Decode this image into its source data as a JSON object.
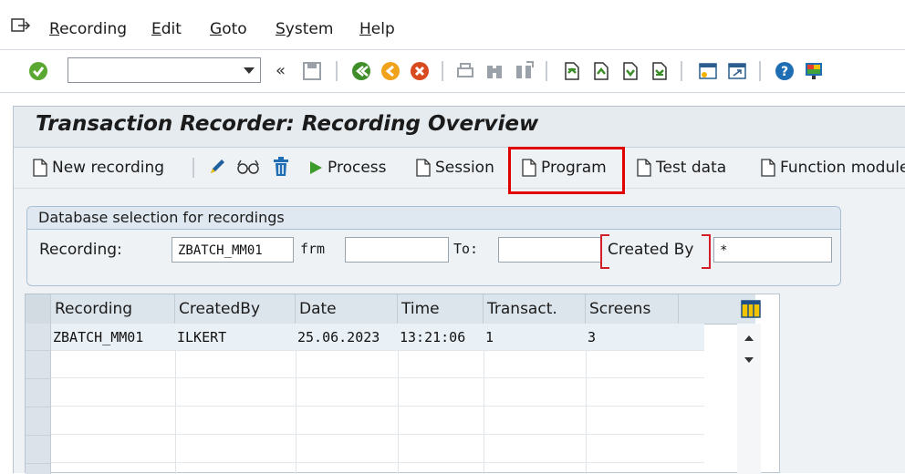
{
  "menu": {
    "items": [
      {
        "id": "recording",
        "accel": "R",
        "rest": "ecording"
      },
      {
        "id": "edit",
        "accel": "E",
        "rest": "dit"
      },
      {
        "id": "goto",
        "accel": "G",
        "rest": "oto"
      },
      {
        "id": "system",
        "accel": "S",
        "rest": "ystem"
      },
      {
        "id": "help",
        "accel": "H",
        "rest": "elp"
      }
    ]
  },
  "toolbar": {
    "command_value": "",
    "back_symbol": "«"
  },
  "app": {
    "title": "Transaction Recorder: Recording Overview",
    "buttons": {
      "new_recording": "New recording",
      "process": "Process",
      "session": "Session",
      "program": "Program",
      "test_data": "Test data",
      "function_module": "Function module"
    }
  },
  "selection": {
    "group_title": "Database selection for recordings",
    "recording_label": "Recording:",
    "recording_value": "ZBATCH_MM01",
    "from_label": "frm",
    "from_value": "",
    "to_label": "To:",
    "to_value": "",
    "created_by_label": "Created By",
    "created_by_value": "*"
  },
  "table": {
    "columns": [
      "Recording",
      "CreatedBy",
      "Date",
      "Time",
      "Transact.",
      "Screens"
    ],
    "rows": [
      [
        "ZBATCH_MM01",
        "ILKERT",
        "25.06.2023",
        "13:21:06",
        "1",
        "3"
      ]
    ]
  },
  "colors": {
    "highlight": "#e00000",
    "bracket": "#d21f2a"
  }
}
